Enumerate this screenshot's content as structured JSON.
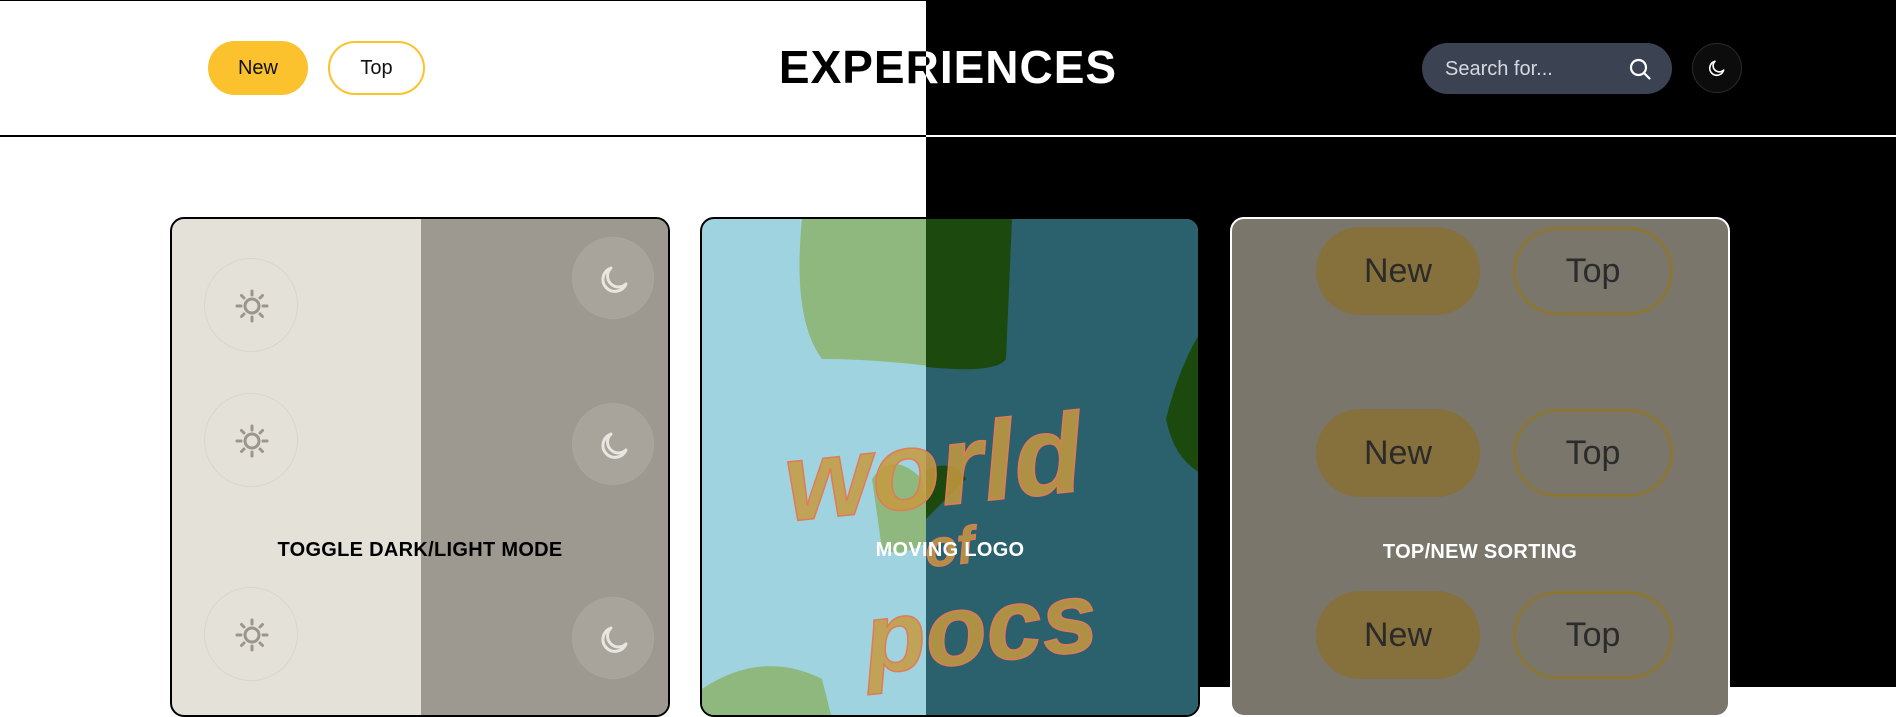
{
  "header": {
    "title": "EXPERIENCES",
    "sort_new_label": "New",
    "sort_top_label": "Top",
    "search_placeholder": "Search for...",
    "search_icon": "search-icon",
    "theme_toggle_icon": "moon-icon"
  },
  "colors": {
    "accent": "#fbc22e",
    "search_bg": "#3b4252",
    "dark_bg": "#000000",
    "light_bg": "#ffffff"
  },
  "cards": [
    {
      "label": "TOGGLE DARK/LIGHT MODE",
      "icons": [
        "sun-icon",
        "moon-icon"
      ]
    },
    {
      "label": "MOVING LOGO",
      "logo_words": [
        "world",
        "of",
        "pocs"
      ]
    },
    {
      "label": "TOP/NEW SORTING",
      "pill_new": "New",
      "pill_top": "Top"
    }
  ]
}
